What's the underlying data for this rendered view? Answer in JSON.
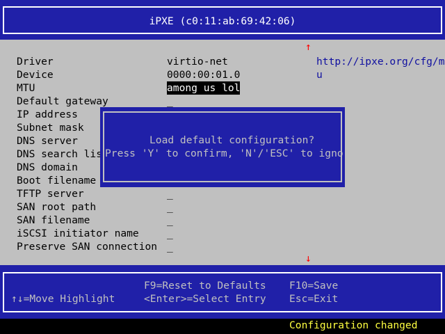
{
  "title": "iPXE (c0:11:ab:69:42:06)",
  "scroll_up_arrow": "↑",
  "scroll_down_arrow": "↓",
  "help_url": "http://ipxe.org/cfg/mtu",
  "help_url_line1": "http://ipxe.org/cfg/mt",
  "help_url_line2": "u",
  "settings": [
    {
      "label": "Driver",
      "value": "virtio-net"
    },
    {
      "label": "Device",
      "value": "0000:00:01.0"
    },
    {
      "label": "MTU",
      "value": "among us lol",
      "selected": true
    },
    {
      "label": "Default gateway",
      "value": "_"
    },
    {
      "label": "IP address",
      "value": ""
    },
    {
      "label": "Subnet mask",
      "value": ""
    },
    {
      "label": "DNS server",
      "value": ""
    },
    {
      "label": "DNS search list",
      "value": ""
    },
    {
      "label": "DNS domain",
      "value": ""
    },
    {
      "label": "Boot filename",
      "value": ""
    },
    {
      "label": "TFTP server",
      "value": "_"
    },
    {
      "label": "SAN root path",
      "value": "_"
    },
    {
      "label": "SAN filename",
      "value": "_"
    },
    {
      "label": "iSCSI initiator name",
      "value": "_"
    },
    {
      "label": "Preserve SAN connection",
      "value": "_"
    }
  ],
  "dialog": {
    "line1": "Load default configuration?",
    "line2": "Press 'Y' to confirm, 'N'/'ESC' to ignore."
  },
  "footer": {
    "move_highlight": "↑↓=Move Highlight",
    "reset": "F9=Reset to Defaults",
    "select": "<Enter>=Select Entry",
    "save": "F10=Save",
    "exit": "Esc=Exit"
  },
  "status": "Configuration changed",
  "colors": {
    "blue": "#2020a8",
    "gray": "#c0c0c0",
    "status_yellow": "#ffff40",
    "arrow_red": "#ff0000"
  }
}
